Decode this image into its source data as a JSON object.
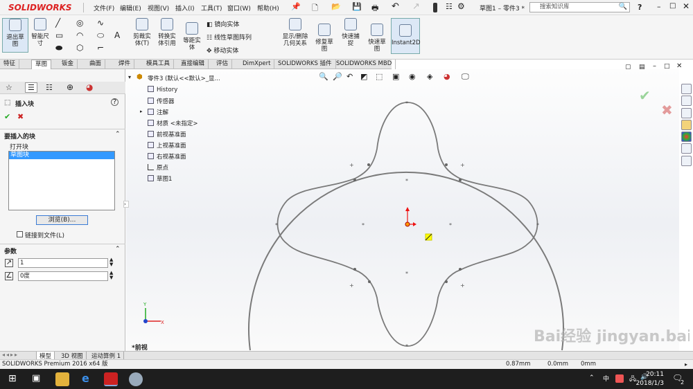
{
  "app": {
    "logo": "SOLIDWORKS",
    "title": "草图1 – 零件3 *",
    "search_placeholder": "搜索知识库"
  },
  "menu": [
    "文件(F)",
    "编辑(E)",
    "视图(V)",
    "插入(I)",
    "工具(T)",
    "窗口(W)",
    "帮助(H)"
  ],
  "ribbon": {
    "exit_sketch": "退出草\n图",
    "smart_dim": "智能尺\n寸",
    "cut_entity": "剪裁实\n体(T)",
    "convert_entity": "转换实\n体引用",
    "offset_entity": "等距实\n体",
    "mirror": "镜向实体",
    "linear_pattern": "线性草图阵列",
    "move": "移动实体",
    "show_relations": "显示/删除\n几何关系",
    "repair": "修复草\n图",
    "quick_snap": "快速捕\n捉",
    "rapid_sketch": "快速草\n图",
    "instant2d": "Instant2D"
  },
  "tabs": [
    "特征",
    "草图",
    "钣金",
    "曲面",
    "焊件",
    "模具工具",
    "直接编辑",
    "评估",
    "DimXpert",
    "SOLIDWORKS 插件",
    "SOLIDWORKS MBD"
  ],
  "active_tab": 1,
  "panel": {
    "title": "插入块",
    "section1": "要插入的块",
    "open_block": "打开块",
    "list_item": "草图块",
    "browse": "浏览(B)...",
    "link_label": "链接到文件(L)",
    "section2": "参数",
    "scale_value": "1",
    "angle_value": "0度"
  },
  "tree": {
    "root": "零件3 (默认<<默认>_显...",
    "items": [
      "History",
      "传感器",
      "注解",
      "材质 <未指定>",
      "前视基准面",
      "上视基准面",
      "右视基准面",
      "原点",
      "草图1"
    ]
  },
  "view_label": "*前视",
  "bottom_tabs": [
    "模型",
    "3D 视图",
    "运动算例 1"
  ],
  "status": {
    "text": "SOLIDWORKS Premium 2016 x64 版",
    "coord": "0.87mm",
    "coord2": "0.0mm",
    "coord3": "0mm"
  },
  "taskbar": {
    "time": "20:11",
    "date": "2018/1/3",
    "ime": "中",
    "notify": "2"
  },
  "watermark": "Bai经验 jingyan.baidu.com"
}
